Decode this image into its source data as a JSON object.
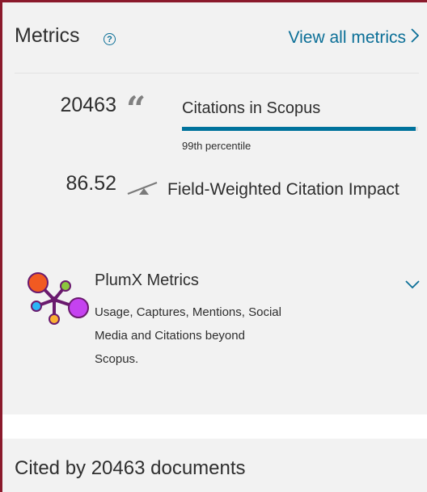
{
  "metrics": {
    "title": "Metrics",
    "help_icon": "question-circle-icon",
    "view_all_label": "View all metrics",
    "view_all_icon": "chevron-right-icon",
    "accent_color": "#00729c"
  },
  "citations": {
    "count": "20463",
    "icon": "quote-icon",
    "label": "Citations in Scopus",
    "percentile": "99th percentile",
    "percentile_value": 99
  },
  "fwci": {
    "value": "86.52",
    "icon": "balance-icon",
    "label": "Field-Weighted Citation Impact"
  },
  "plumx": {
    "logo_icon": "plumx-logo",
    "title": "PlumX Metrics",
    "description": "Usage, Captures, Mentions, Social Media and Citations beyond Scopus.",
    "expand_icon": "chevron-down-icon"
  },
  "cited_by": {
    "title": "Cited by 20463 documents"
  }
}
